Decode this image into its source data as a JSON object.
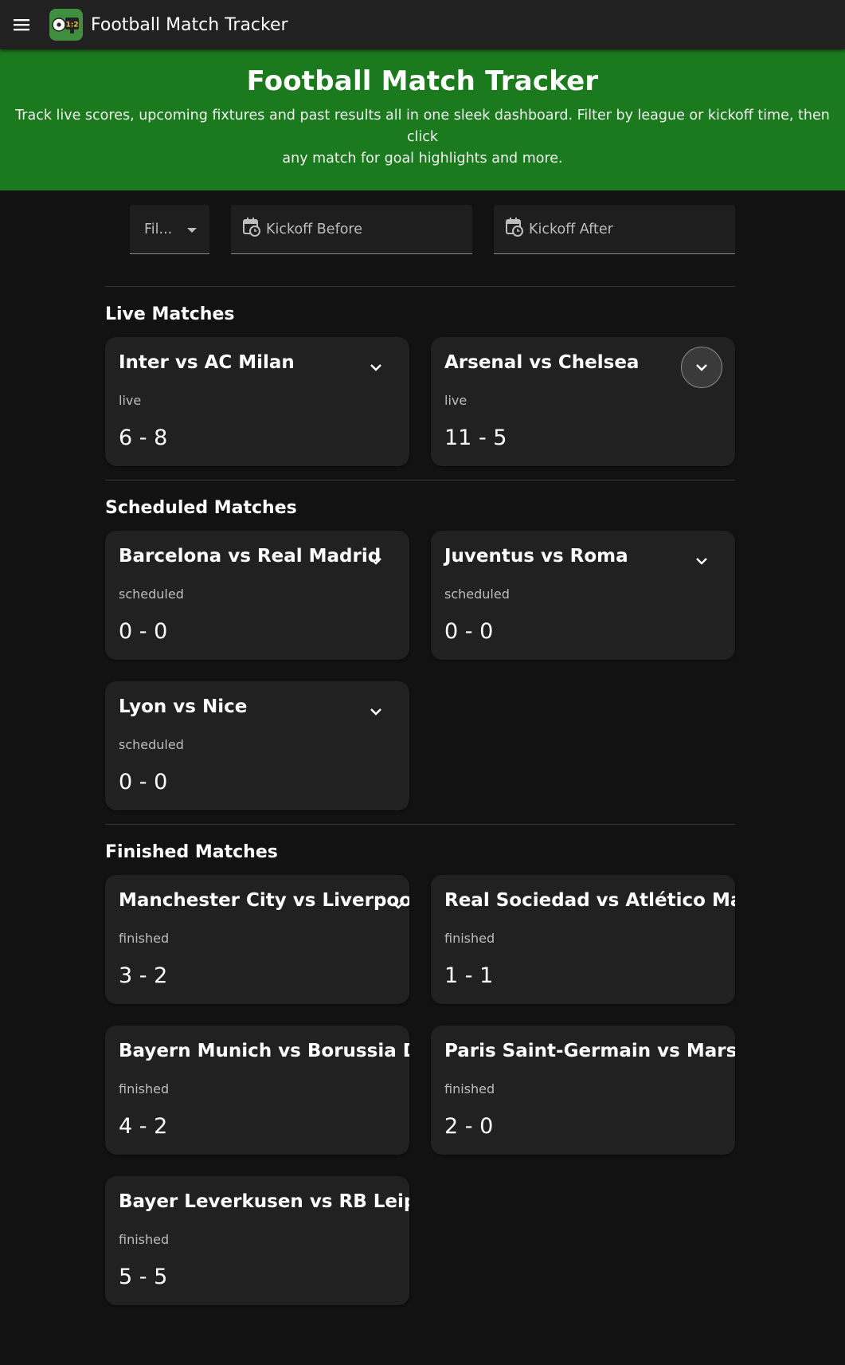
{
  "appbar": {
    "title": "Football Match Tracker"
  },
  "hero": {
    "title": "Football Match Tracker",
    "description_line1": "Track live scores, upcoming fixtures and past results all in one sleek dashboard. Filter by league or kickoff time, then click",
    "description_line2": "any match for goal highlights and more."
  },
  "filters": {
    "league_label": "Fil...",
    "kickoff_before": "Kickoff Before",
    "kickoff_after": "Kickoff After"
  },
  "sections": {
    "live": {
      "title": "Live Matches",
      "matches": [
        {
          "name": "Inter vs AC Milan",
          "status": "live",
          "score": "6 - 8"
        },
        {
          "name": "Arsenal vs Chelsea",
          "status": "live",
          "score": "11 - 5"
        }
      ]
    },
    "scheduled": {
      "title": "Scheduled Matches",
      "matches": [
        {
          "name": "Barcelona vs Real Madrid",
          "status": "scheduled",
          "score": "0 - 0"
        },
        {
          "name": "Juventus vs Roma",
          "status": "scheduled",
          "score": "0 - 0"
        },
        {
          "name": "Lyon vs Nice",
          "status": "scheduled",
          "score": "0 - 0"
        }
      ]
    },
    "finished": {
      "title": "Finished Matches",
      "matches": [
        {
          "name": "Manchester City vs Liverpool",
          "status": "finished",
          "score": "3 - 2"
        },
        {
          "name": "Real Sociedad vs Atlético Madrid",
          "status": "finished",
          "score": "1 - 1"
        },
        {
          "name": "Bayern Munich vs Borussia Dortmund",
          "status": "finished",
          "score": "4 - 2"
        },
        {
          "name": "Paris Saint-Germain vs Marseille",
          "status": "finished",
          "score": "2 - 0"
        },
        {
          "name": "Bayer Leverkusen vs RB Leipzig",
          "status": "finished",
          "score": "5 - 5"
        }
      ]
    }
  },
  "colors": {
    "appbar": "#212121",
    "hero": "#1b7a1e",
    "background": "#121212",
    "card": "#212121"
  }
}
